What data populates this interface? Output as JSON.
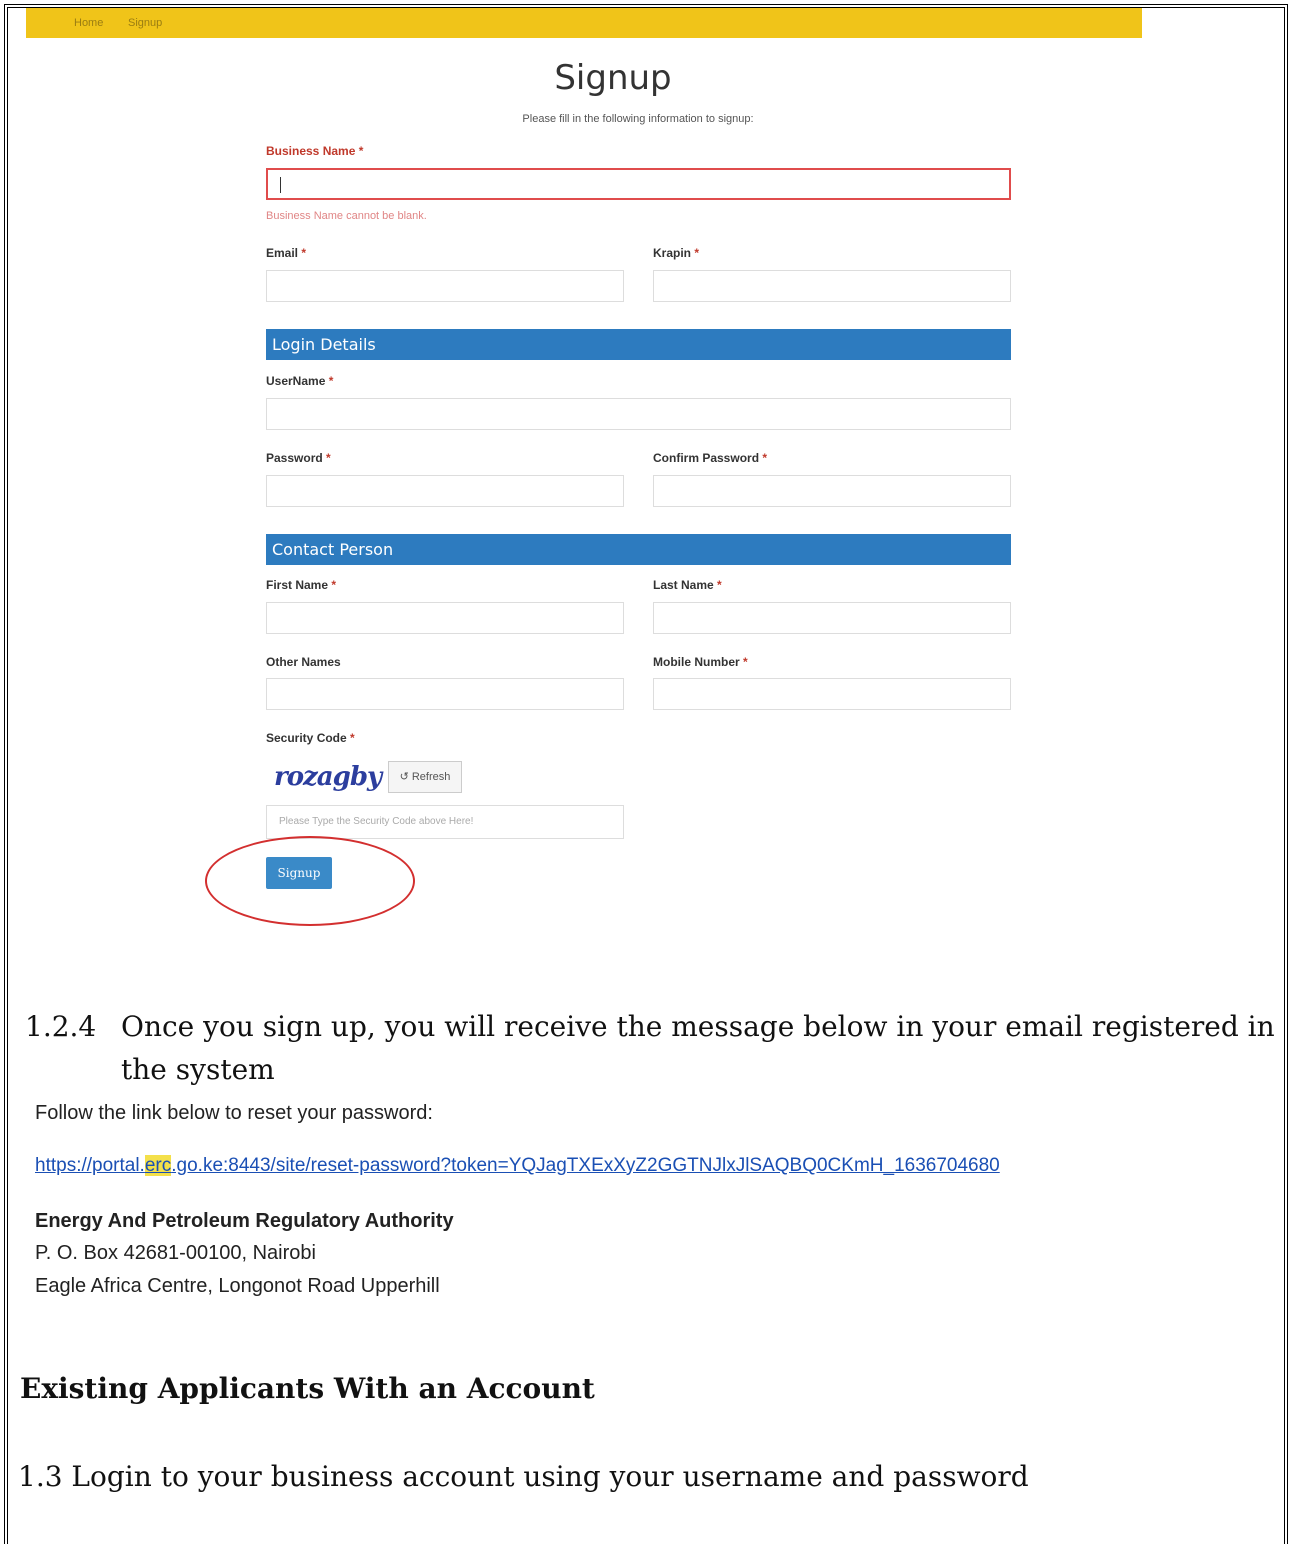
{
  "nav": {
    "home": "Home",
    "signup": "Signup"
  },
  "form": {
    "title": "Signup",
    "subtitle": "Please fill in the following information to signup:",
    "business_name_label": "Business Name",
    "business_name_error": "Business Name cannot be blank.",
    "email_label": "Email",
    "krapin_label": "Krapin",
    "section_login": "Login Details",
    "username_label": "UserName",
    "password_label": "Password",
    "confirm_password_label": "Confirm Password",
    "section_contact": "Contact Person",
    "first_name_label": "First Name",
    "last_name_label": "Last Name",
    "other_names_label": "Other Names",
    "mobile_label": "Mobile Number",
    "security_code_label": "Security Code",
    "captcha_text": "rozagby",
    "refresh_label": "↺ Refresh",
    "security_placeholder": "Please Type the Security Code above Here!",
    "signup_button": "Signup",
    "required_mark": "*"
  },
  "doc": {
    "step_number": "1.2.4",
    "step_text_line1": "Once you sign up, you will receive the message below in your email registered in",
    "step_text_line2": "the system",
    "email_intro": "Follow the link below to reset your password:",
    "link_part1": "https://portal.",
    "link_highlight": "erc",
    "link_part2": ".go.ke:8443/site/reset-password?token=YQJagTXExXyZ2GGTNJlxJlSAQBQ0CKmH_1636704680",
    "org_name": "Energy And Petroleum Regulatory Authority",
    "address_line1": "P. O. Box 42681-00100, Nairobi",
    "address_line2": "Eagle Africa Centre, Longonot Road Upperhill",
    "section_heading": "Existing Applicants With an Account",
    "step_13": "1.3 Login to your business account using your username and password"
  }
}
